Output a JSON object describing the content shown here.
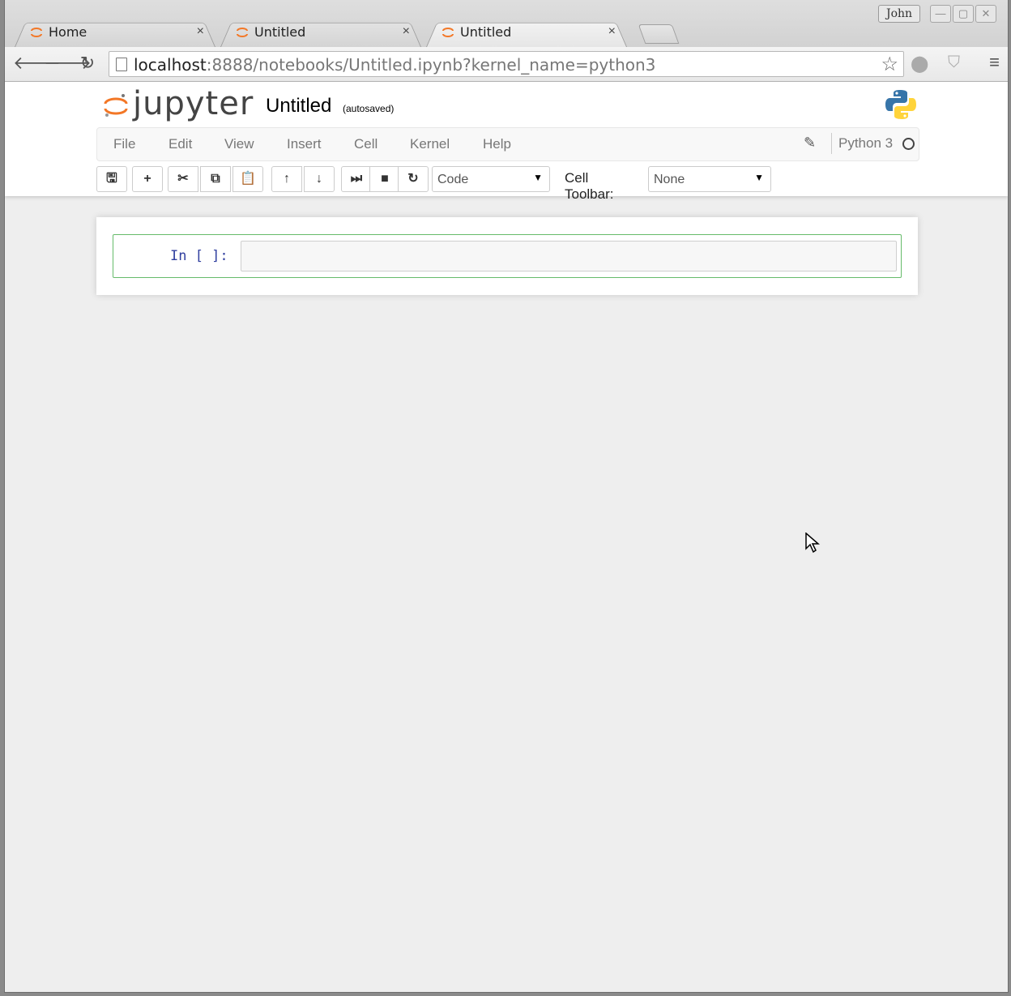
{
  "browser": {
    "tabs": [
      {
        "title": "Home",
        "close": "×",
        "active": false
      },
      {
        "title": "Untitled",
        "close": "×",
        "active": false
      },
      {
        "title": "Untitled",
        "close": "×",
        "active": true
      }
    ],
    "profile_name": "John",
    "url_host": "localhost",
    "url_rest": ":8888/notebooks/Untitled.ipynb?kernel_name=python3",
    "accent_color": "#f37726"
  },
  "jupyter": {
    "logo_text": "jupyter",
    "notebook_title": "Untitled",
    "save_status": "(autosaved)",
    "menu": [
      "File",
      "Edit",
      "View",
      "Insert",
      "Cell",
      "Kernel",
      "Help"
    ],
    "kernel_name": "Python 3",
    "toolbar": {
      "cell_type": "Code",
      "cell_toolbar_label": "Cell Toolbar:",
      "cell_toolbar_value": "None"
    },
    "cells": [
      {
        "prompt": "In [ ]:",
        "source": ""
      }
    ]
  }
}
